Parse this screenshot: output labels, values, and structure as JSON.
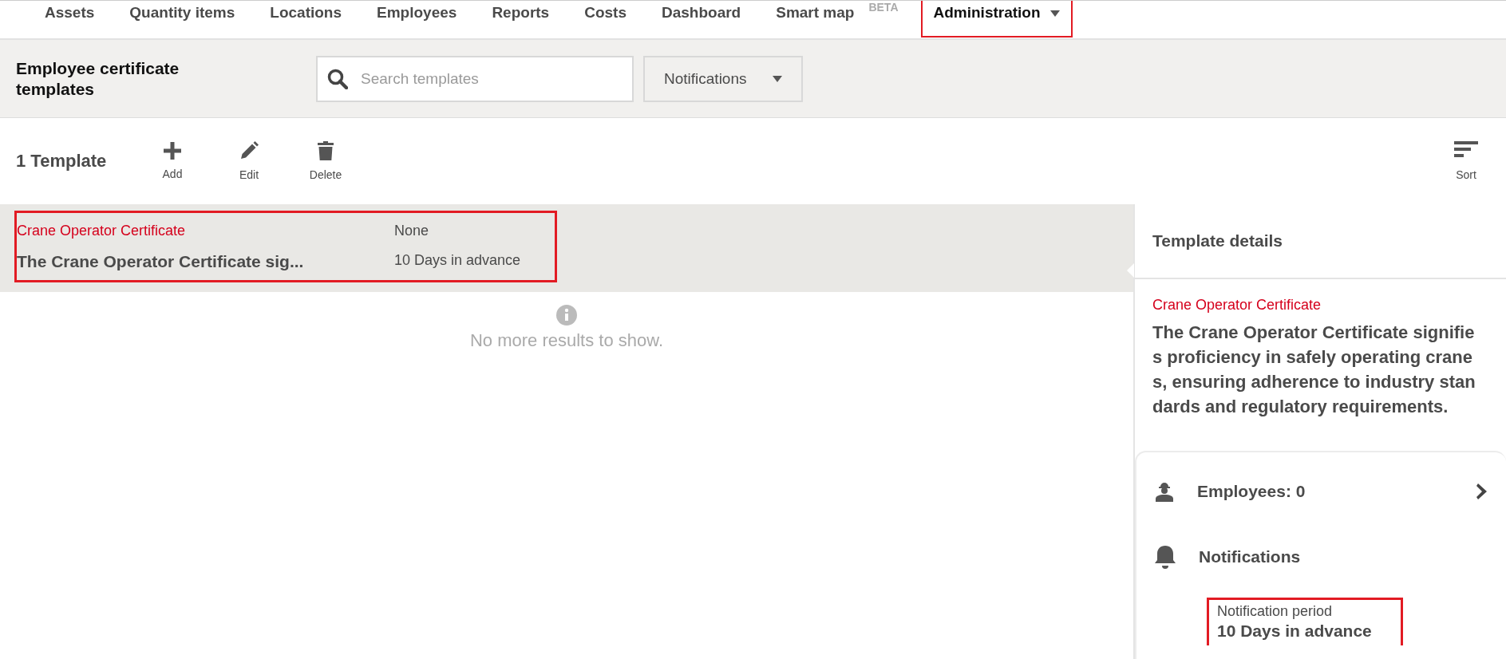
{
  "nav": {
    "items": [
      {
        "label": "Assets",
        "selected": false,
        "highlighted": false
      },
      {
        "label": "Quantity items",
        "selected": false,
        "highlighted": false
      },
      {
        "label": "Locations",
        "selected": false,
        "highlighted": false
      },
      {
        "label": "Employees",
        "selected": false,
        "highlighted": false
      },
      {
        "label": "Reports",
        "selected": false,
        "highlighted": false
      },
      {
        "label": "Costs",
        "selected": false,
        "highlighted": false
      },
      {
        "label": "Dashboard",
        "selected": false,
        "highlighted": false
      },
      {
        "label": "Smart map",
        "badge": "BETA",
        "selected": false,
        "highlighted": false
      },
      {
        "label": "Administration",
        "selected": true,
        "highlighted": true,
        "dropdown": true
      }
    ]
  },
  "header": {
    "title": "Employee certificate templates",
    "search": {
      "placeholder": "Search templates"
    },
    "filter": "Notifications"
  },
  "toolbar": {
    "count": "1 Template",
    "actions": [
      {
        "kind": "add",
        "label": "Add"
      },
      {
        "kind": "edit",
        "label": "Edit"
      },
      {
        "kind": "delete",
        "label": "Delete"
      }
    ],
    "sort": "Sort"
  },
  "list": {
    "rows": [
      {
        "name": "Crane Operator Certificate",
        "status": "None",
        "description": "The Crane Operator Certificate sig...",
        "notification": "10 Days in advance",
        "selected": true,
        "highlighted": true
      }
    ],
    "end_message": "No more results to show."
  },
  "details": {
    "title": "Template details",
    "name": "Crane Operator Certificate",
    "description": "The Crane Operator Certificate signifies proficiency in safely operating cranes, ensuring adherence to industry standards and regulatory requirements.",
    "employees": "Employees: 0",
    "notifications_heading": "Notifications",
    "period_label": "Notification period",
    "period_value": "10 Days in advance",
    "period_highlighted": true
  }
}
